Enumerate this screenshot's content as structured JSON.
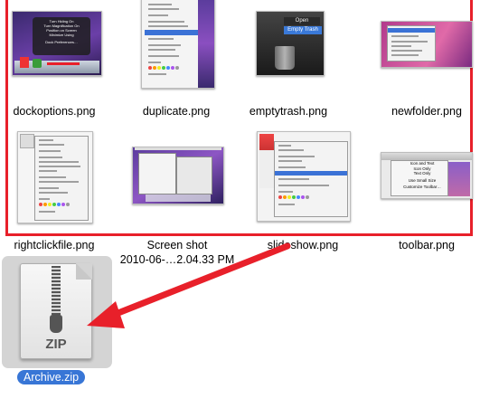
{
  "files": [
    {
      "name": "dockoptions.png"
    },
    {
      "name": "duplicate.png"
    },
    {
      "name": "emptytrash.png"
    },
    {
      "name": "newfolder.png"
    },
    {
      "name": "rightclickfile.png"
    },
    {
      "name": "Screen shot 2010-06-…2.04.33 PM",
      "line1": "Screen shot",
      "line2": "2010-06-…2.04.33 PM"
    },
    {
      "name": "slideshow.png"
    },
    {
      "name": "toolbar.png"
    }
  ],
  "thumb_text": {
    "dock_menu": [
      "Turn Hiding On",
      "Turn Magnification On",
      "Position on Screen",
      "Minimize Using",
      "Dock Preferences…"
    ],
    "trash_open": "Open",
    "trash_empty": "Empty Trash",
    "toolbar_menu": [
      "Icon and Text",
      "Icon Only",
      "Text Only",
      "Use Small Size",
      "Customize Toolbar…"
    ]
  },
  "archive": {
    "name": "Archive.zip",
    "icon_label": "ZIP"
  },
  "colors": {
    "selection_border": "#e8202a",
    "arrow": "#e8202a",
    "label_highlight": "#3876d6"
  }
}
